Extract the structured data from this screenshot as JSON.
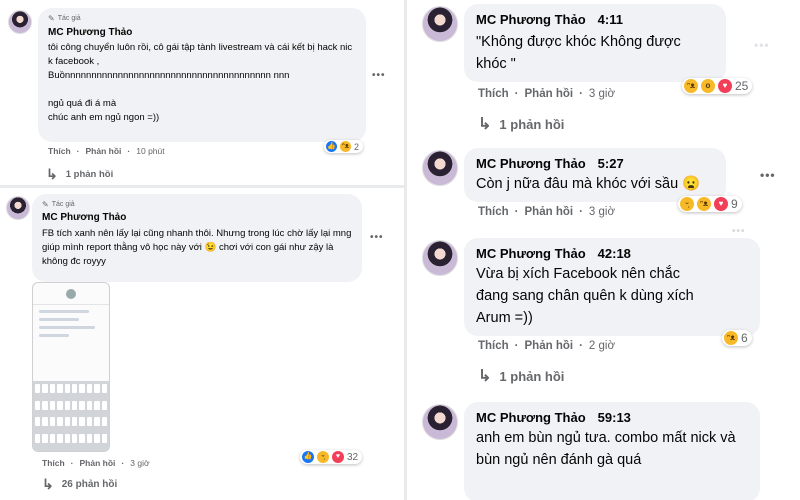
{
  "comments_left": [
    {
      "author_tag": "Tác giả",
      "name": "MC Phương Thảo",
      "text": "tôi công chuyển luôn rồi, cô gái tập tành livestream và cái kết bị hack nick facebook ,\nBuồnnnnnnnnnnnnnnnnnnnnnnnnnnnnnnnnnnnnnnn nnn\n\nngủ quá đi á mà\nchúc anh em ngủ ngon =))",
      "actions": {
        "like": "Thích",
        "reply": "Phản hồi",
        "time": "10 phút"
      },
      "reaction_count": "2",
      "reaction_icons": [
        "like",
        "haha"
      ],
      "replies": "1 phản hồi"
    },
    {
      "author_tag": "Tác giả",
      "name": "MC Phương Thảo",
      "text": "FB tích xanh nên lấy lại cũng nhanh thôi. Nhưng trong lúc chờ lấy lại mng giúp mình report thằng vô học này với 😉 chơi với con gái như zậy là không đc royyy",
      "actions": {
        "like": "Thích",
        "reply": "Phản hồi",
        "time": "3 giờ"
      },
      "reaction_count": "32",
      "reaction_icons": [
        "like",
        "sad",
        "love"
      ],
      "replies": "26 phản hồi"
    }
  ],
  "comments_right": [
    {
      "name": "MC Phương Thảo",
      "timestamp": "4:11",
      "text": "\"Không được khóc Không được khóc \"",
      "actions": {
        "like": "Thích",
        "reply": "Phản hồi",
        "time": "3 giờ"
      },
      "reaction_count": "25",
      "reaction_icons": [
        "haha",
        "wow",
        "love"
      ],
      "replies": "1 phản hồi"
    },
    {
      "name": "MC Phương Thảo",
      "timestamp": "5:27",
      "text": "Còn j nữa đâu mà khóc với sầu 😦",
      "actions": {
        "like": "Thích",
        "reply": "Phản hồi",
        "time": "3 giờ"
      },
      "reaction_count": "9",
      "reaction_icons": [
        "sad",
        "haha",
        "love"
      ]
    },
    {
      "name": "MC Phương Thảo",
      "timestamp": "42:18",
      "text": "Vừa bị xích Facebook nên chắc đang sang chân quên k dùng xích Arum =))",
      "actions": {
        "like": "Thích",
        "reply": "Phản hồi",
        "time": "2 giờ"
      },
      "reaction_count": "6",
      "reaction_icons": [
        "haha"
      ],
      "replies": "1 phản hồi"
    },
    {
      "name": "MC Phương Thảo",
      "timestamp": "59:13",
      "text": "anh em bùn ngủ tưa. combo mất nick và bùn ngủ nên đánh gà quá"
    }
  ],
  "icons": {
    "more": "more-options-icon",
    "reply_arrow": "reply-arrow-icon",
    "pen": "pen-icon"
  },
  "colors": {
    "bubble": "#f0f2f5",
    "meta": "#65676b",
    "like": "#1877f2",
    "love": "#f33e58",
    "haha": "#f7b928"
  }
}
